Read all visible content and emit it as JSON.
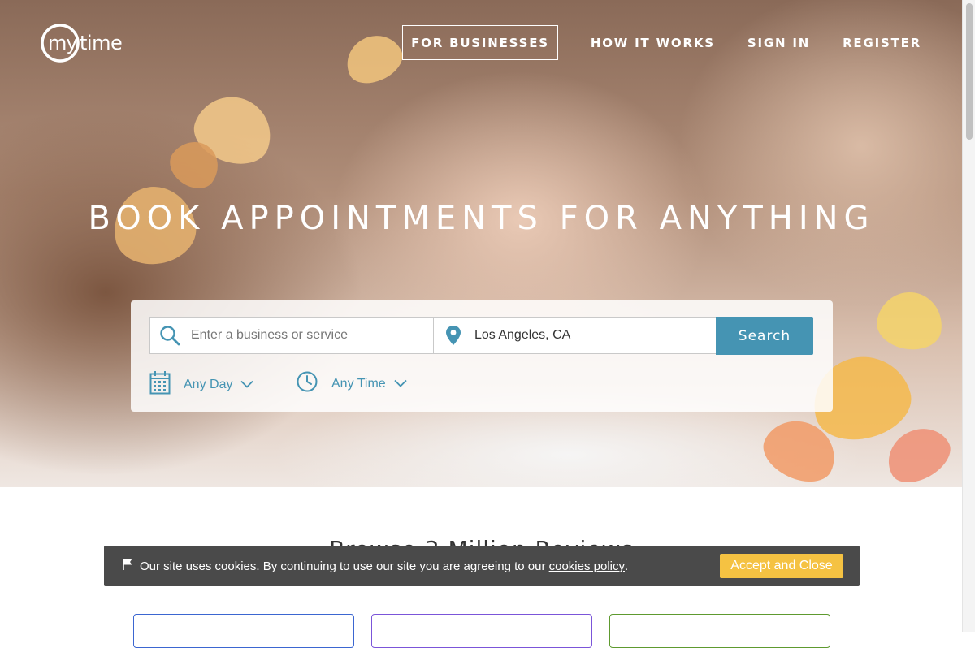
{
  "brand": {
    "name": "mytime"
  },
  "nav": {
    "for_businesses": "FOR BUSINESSES",
    "how_it_works": "HOW IT WORKS",
    "sign_in": "SIGN IN",
    "register": "REGISTER"
  },
  "hero": {
    "headline": "BOOK APPOINTMENTS FOR ANYTHING"
  },
  "search": {
    "service_placeholder": "Enter a business or service",
    "location_value": "Los Angeles, CA",
    "button_label": "Search",
    "day_label": "Any Day",
    "time_label": "Any Time"
  },
  "section": {
    "heading_partial": "Browse 3 Million Reviews"
  },
  "cookie_bar": {
    "message": "Our site uses cookies. By continuing to use our site you are agreeing to our ",
    "link_text": "cookies policy",
    "period": ".",
    "accept_label": "Accept and Close"
  },
  "colors": {
    "accent": "#4594b3",
    "cookie_bar_bg": "#4a4a4a",
    "accept_button": "#f5c242",
    "card_borders": [
      "#3b66d1",
      "#7b55d9",
      "#5e9a2f"
    ]
  },
  "icons": [
    "search-icon",
    "location-pin-icon",
    "calendar-icon",
    "clock-icon",
    "chevron-down-icon",
    "flag-icon"
  ]
}
